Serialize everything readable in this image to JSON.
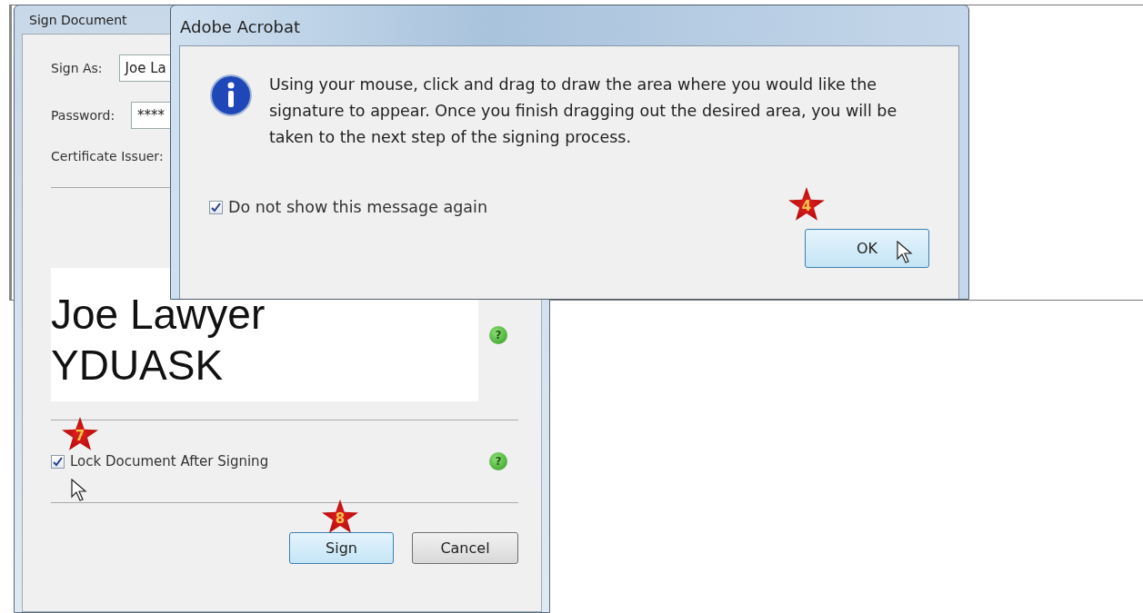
{
  "sign_window": {
    "title": "Sign Document",
    "fields": [
      {
        "label": "Sign As:",
        "value": "Joe La"
      },
      {
        "label": "Password:",
        "value": "****"
      }
    ],
    "certificate_label": "Certificate Issuer:",
    "signature_lines": [
      "Joe Lawyer",
      "YDUASK"
    ],
    "signature_help": "?",
    "lock": {
      "label": "Lock Document After Signing",
      "checked": true,
      "help": "?",
      "step": "7"
    },
    "buttons": [
      {
        "label": "Sign",
        "default": true,
        "step": "8"
      },
      {
        "label": "Cancel",
        "default": false
      }
    ]
  },
  "alert": {
    "title": "Adobe Acrobat",
    "message": "Using your mouse, click and drag to draw the area where you would like the signature to appear. Once you finish dragging out the desired area, you will be taken to the next step of the signing process.",
    "checkbox": {
      "label": "Do not show this message again",
      "checked": true
    },
    "button": {
      "label": "OK",
      "step": "4"
    }
  }
}
